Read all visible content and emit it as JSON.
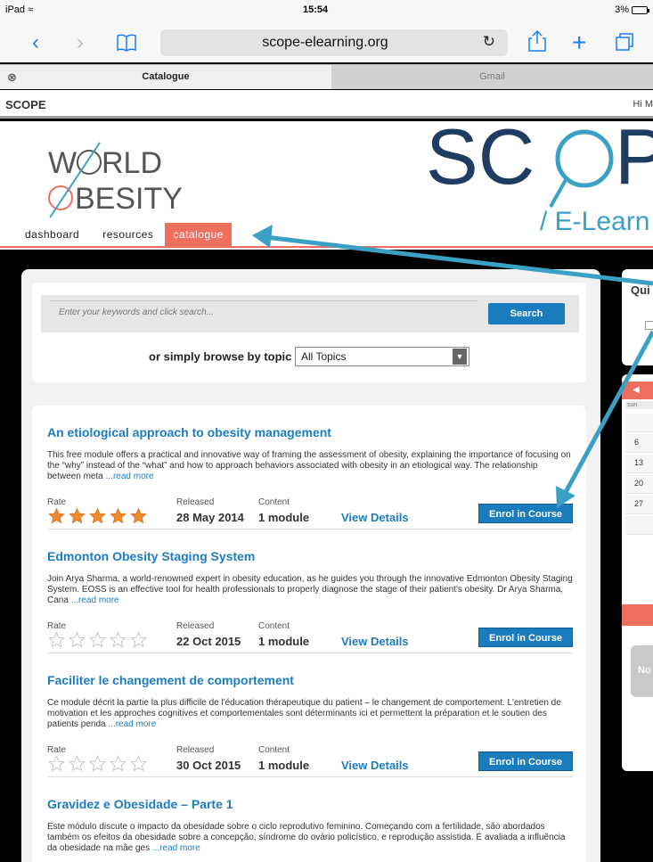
{
  "status_bar": {
    "device": "iPad",
    "time": "15:54",
    "battery": "3%"
  },
  "browser": {
    "url": "scope-elearning.org",
    "tabs": [
      {
        "label": "Catalogue",
        "active": true
      },
      {
        "label": "Gmail",
        "active": false
      }
    ]
  },
  "site_bar": {
    "brand": "SCOPE",
    "greeting": "Hi M"
  },
  "header": {
    "logo_left_line1": "W",
    "logo_left_line1b": "RLD",
    "logo_left_line2": "BESITY",
    "logo_right_big": "SC",
    "logo_right_big2": "P",
    "logo_right_sub": "/ E-Learn",
    "nav": [
      "dashboard",
      "resources",
      "catalogue"
    ]
  },
  "search": {
    "placeholder": "Enter your keywords and click search...",
    "button": "Search",
    "browse_label": "or simply browse by topic",
    "topic_selected": "All Topics"
  },
  "labels": {
    "rate": "Rate",
    "released": "Released",
    "content": "Content",
    "view_details": "View Details",
    "enrol": "Enrol in Course",
    "read_more": "...read more"
  },
  "courses": [
    {
      "title": "An etiological approach to obesity management",
      "desc": "This free module offers a practical and innovative way of framing the assessment of obesity, explaining the importance of focusing on the “why” instead of the “what” and how to approach behaviors associated with obesity in an etiological way. The relationship between meta ",
      "released": "28 May 2014",
      "content": "1 module",
      "rating": 5
    },
    {
      "title": "Edmonton Obesity Staging System",
      "desc": "Join Arya Sharma, a world-renowned expert in obesity education, as he guides you through the innovative Edmonton Obesity Staging System. EOSS is an effective tool for health professionals to properly diagnose the stage of their patient's obesity.  Dr Arya Sharma, Cana ",
      "released": "22 Oct 2015",
      "content": "1 module",
      "rating": 0
    },
    {
      "title": "Faciliter le changement de comportement",
      "desc": "Ce module décrit la partie la plus difficile de l'éducation thérapeutique du patient – le changement de comportement. L'entretien de motivation et les approches cognitives et comportementales sont déterminants ici et permettent la préparation et le soutien des patients penda ",
      "released": "30 Oct 2015",
      "content": "1 module",
      "rating": 0
    },
    {
      "title": "Gravidez e Obesidade – Parte 1",
      "desc": "Este módulo discute o impacto da obesidade sobre o ciclo reprodutivo feminino. Começando com a fertilidade, são abordados também os efeitos da obesidade sobre a concepção, síndrome do ovário policístico, e reprodução assistida. É avaliada a influência da obesidade na mãe ges ",
      "released": "",
      "content": "",
      "rating": 0
    }
  ],
  "sidebar": {
    "quick_title": "Qui",
    "cal_dow": "sun",
    "cal_days": [
      "",
      "6",
      "13",
      "20",
      "27",
      ""
    ],
    "notice": "No"
  },
  "colors": {
    "accent": "#ee6f5d",
    "link": "#1d7cc0",
    "button": "#1a7bbd",
    "arrow": "#3aa0c4"
  }
}
